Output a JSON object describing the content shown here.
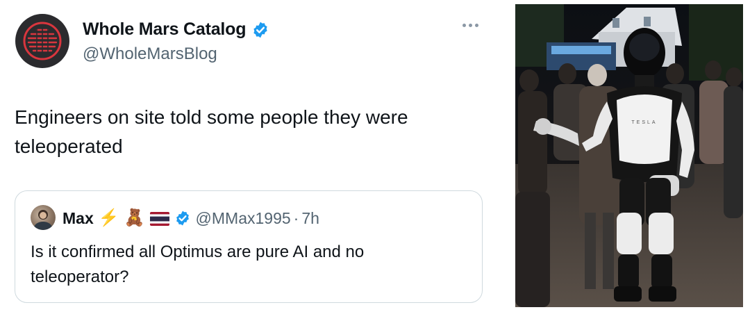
{
  "tweet": {
    "display_name": "Whole Mars Catalog",
    "handle": "@WholeMarsBlog",
    "text": "Engineers on site told some people they were teleoperated"
  },
  "quote": {
    "display_name": "Max",
    "emoji": [
      "⚡",
      "🧸",
      "🇹🇭"
    ],
    "handle": "@MMax1995",
    "separator": "·",
    "time": "7h",
    "text": "Is it confirmed all Optimus are pure AI and no teleoperator?"
  },
  "photo": {
    "robot_chest_text": "TESLA",
    "icon": "crowd-with-humanoid-robot-photo"
  },
  "colors": {
    "verified": "#1d9bf0",
    "handle_gray": "#536471",
    "border": "#cfd9de",
    "avatar_bg": "#2b2b2e",
    "avatar_accent": "#d9363e"
  },
  "icons": [
    "verified-badge-icon",
    "more-options-icon"
  ]
}
